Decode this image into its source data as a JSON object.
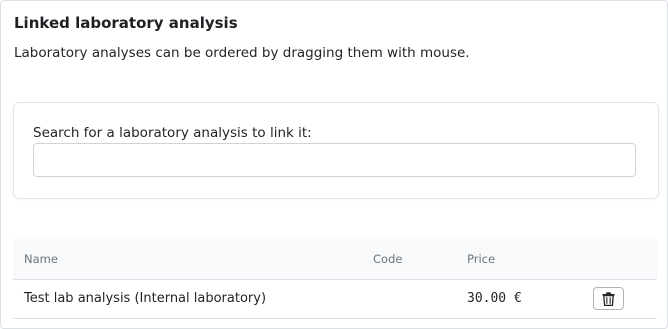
{
  "section": {
    "title": "Linked laboratory analysis",
    "description": "Laboratory analyses can be ordered by dragging them with mouse."
  },
  "search": {
    "label": "Search for a laboratory analysis to link it:",
    "value": ""
  },
  "table": {
    "columns": {
      "name": "Name",
      "code": "Code",
      "price": "Price"
    },
    "rows": [
      {
        "name": "Test lab analysis (Internal laboratory)",
        "code": "",
        "price": "30.00 €",
        "action_icon": "trash-icon"
      }
    ]
  }
}
